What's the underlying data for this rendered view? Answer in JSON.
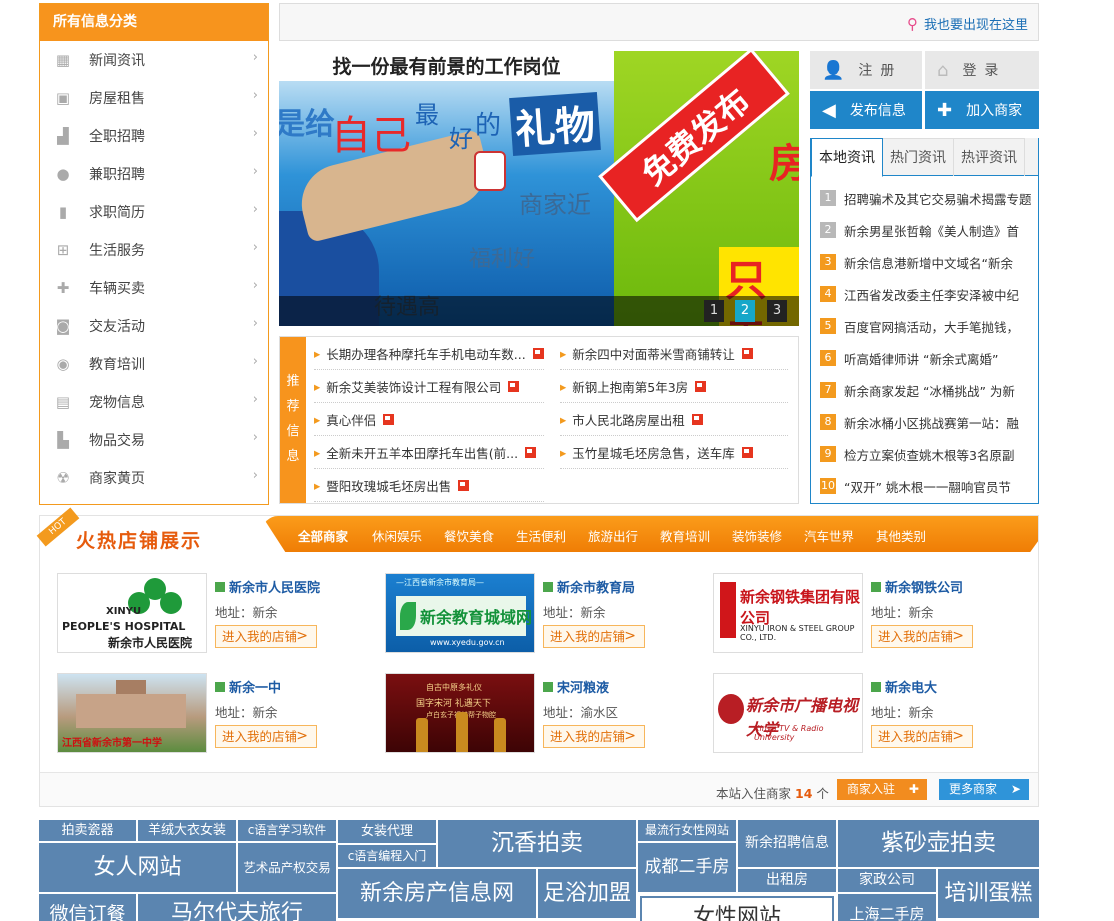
{
  "categories": {
    "title": "所有信息分类",
    "items": [
      {
        "label": "新闻资讯",
        "icon": "calendar-icon"
      },
      {
        "label": "房屋租售",
        "icon": "briefcase-icon"
      },
      {
        "label": "全职招聘",
        "icon": "factory-icon"
      },
      {
        "label": "兼职招聘",
        "icon": "chat-icon"
      },
      {
        "label": "求职简历",
        "icon": "book-icon"
      },
      {
        "label": "生活服务",
        "icon": "cart-icon"
      },
      {
        "label": "车辆买卖",
        "icon": "plus-icon"
      },
      {
        "label": "交友活动",
        "icon": "camera-icon"
      },
      {
        "label": "教育培训",
        "icon": "disc-icon"
      },
      {
        "label": "宠物信息",
        "icon": "building-icon"
      },
      {
        "label": "物品交易",
        "icon": "chart-icon"
      },
      {
        "label": "商家黄页",
        "icon": "radiation-icon"
      }
    ]
  },
  "topbar": {
    "link": "我也要出现在这里"
  },
  "banner": {
    "caption": "找一份最有前景的工作岗位",
    "words": [
      "是给",
      "自己",
      "最",
      "好",
      "的",
      "礼物",
      "商家近",
      "福利好",
      "待遇高"
    ],
    "right_tag": "免费发布",
    "right_big": "房",
    "right_big2": "只需",
    "pages": [
      "1",
      "2",
      "3"
    ],
    "active_page": "2"
  },
  "recommend": {
    "side": [
      "推",
      "荐",
      "信",
      "息"
    ],
    "left": [
      "长期办理各种摩托车手机电动车数...",
      "新余艾美装饰设计工程有限公司",
      "真心伴侣",
      "全新未开五羊本田摩托车出售(前...",
      "暨阳玫瑰城毛坯房出售"
    ],
    "right": [
      "新余四中对面蒂米雪商铺转让",
      "新钢上抱南第5年3房",
      "市人民北路房屋出租",
      "玉竹星城毛坯房急售，送车库"
    ]
  },
  "account": {
    "register": "注册",
    "login": "登录",
    "publish": "发布信息",
    "join": "加入商家"
  },
  "news": {
    "tabs": [
      "本地资讯",
      "热门资讯",
      "热评资讯"
    ],
    "items": [
      {
        "n": "1",
        "t": "招聘骗术及其它交易骗术揭露专题"
      },
      {
        "n": "2",
        "t": "新余男星张哲翰《美人制造》首"
      },
      {
        "n": "3",
        "t": "新余信息港新增中文域名“新余"
      },
      {
        "n": "4",
        "t": "江西省发改委主任李安泽被中纪"
      },
      {
        "n": "5",
        "t": "百度官网搞活动，大手笔抛钱，"
      },
      {
        "n": "6",
        "t": "听高婚律师讲 “新余式离婚”"
      },
      {
        "n": "7",
        "t": "新余商家发起 “冰桶挑战” 为新"
      },
      {
        "n": "8",
        "t": "新余冰桶小区挑战赛第一站：融"
      },
      {
        "n": "9",
        "t": "检方立案侦查姚木根等3名原副"
      },
      {
        "n": "10",
        "t": "“双开” 姚木根一一翮响官员节"
      }
    ]
  },
  "hot": {
    "ribbon": "HOT",
    "title": "火热店铺展示",
    "cats": [
      "全部商家",
      "休闲娱乐",
      "餐饮美食",
      "生活便利",
      "旅游出行",
      "教育培训",
      "装饰装修",
      "汽车世界",
      "其他类别"
    ],
    "shops": [
      {
        "name": "新余市人民医院",
        "addr": "地址：新余",
        "go": "进入我的店铺",
        "logo": {
          "en1": "XINYU",
          "en2": "PEOPLE'S HOSPITAL",
          "zh": "新余市人民医院"
        }
      },
      {
        "name": "新余市教育局",
        "addr": "地址：新余",
        "go": "进入我的店铺",
        "logo": {
          "t0": "—江西省新余市教育局—",
          "t1": "新余教育城域网",
          "t2": "www.xyedu.gov.cn"
        }
      },
      {
        "name": "新余钢铁公司",
        "addr": "地址：新余",
        "go": "进入我的店铺",
        "logo": {
          "t1": "新余钢铁集团有限公司",
          "t2": "XINYU IRON & STEEL GROUP CO., LTD."
        }
      },
      {
        "name": "新余一中",
        "addr": "地址：新余",
        "go": "进入我的店铺",
        "logo": {
          "t1": "江西省新余市第一中学"
        }
      },
      {
        "name": "宋河粮液",
        "addr": "地址：渝水区",
        "go": "进入我的店铺",
        "logo": {
          "t1": "自古中原多礼仪",
          "t2": "国字宋河 礼遇天下",
          "t3": "卢白玄子视其帮子物腔"
        }
      },
      {
        "name": "新余电大",
        "addr": "地址：新余",
        "go": "进入我的店铺",
        "logo": {
          "t1": "新余市广播电视大学",
          "t2": "Xinyu TV & Radio University"
        }
      }
    ],
    "footer": {
      "count_prefix": "本站入住商家",
      "count": "14",
      "count_suffix": "个",
      "join": "商家入驻",
      "more": "更多商家"
    }
  },
  "tags": [
    "拍卖瓷器",
    "羊绒大衣女装",
    "c语言学习软件",
    "女装代理",
    "沉香拍卖",
    "最流行女性网站",
    "新余招聘信息",
    "紫砂壶拍卖",
    "女人网站",
    "艺术品产权交易",
    "c语言编程入门",
    "成都二手房",
    "新余房产信息网",
    "足浴加盟",
    "出租房",
    "家政公司",
    "培训蛋糕",
    "微信订餐",
    "马尔代夫旅行",
    "女性网站",
    "上海二手房"
  ]
}
